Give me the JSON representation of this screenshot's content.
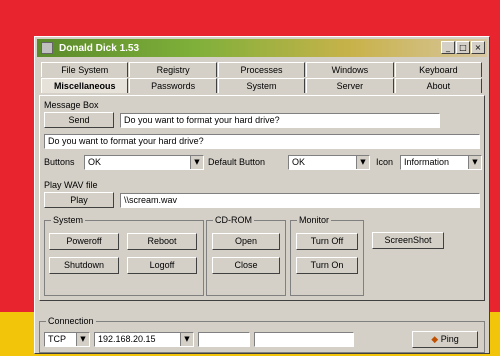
{
  "window": {
    "title": "Donald Dick 1.53",
    "min_label": "_",
    "max_label": "□",
    "close_label": "×"
  },
  "tabs_row1": [
    "File System",
    "Registry",
    "Processes",
    "Windows",
    "Keyboard"
  ],
  "tabs_row2": [
    "Miscellaneous",
    "Passwords",
    "System",
    "Server",
    "About"
  ],
  "message_box": {
    "group_label": "Message Box",
    "send_label": "Send",
    "message_value": "Do you want to format your hard drive?",
    "preview_text": "Do you want to format your hard drive?",
    "buttons_label": "Buttons",
    "buttons_value": "OK",
    "default_button_label": "Default Button",
    "default_button_value": "OK",
    "icon_label": "Icon",
    "icon_value": "Information"
  },
  "play_wav": {
    "group_label": "Play WAV file",
    "play_label": "Play",
    "file_value": "\\\\scream.wav"
  },
  "system": {
    "group_label": "System",
    "poweroff_label": "Poweroff",
    "reboot_label": "Reboot",
    "shutdown_label": "Shutdown",
    "logoff_label": "Logoff"
  },
  "cdrom": {
    "group_label": "CD-ROM",
    "open_label": "Open",
    "close_label": "Close"
  },
  "monitor": {
    "group_label": "Monitor",
    "turn_off_label": "Turn Off",
    "turn_on_label": "Turn On"
  },
  "screenshot_label": "ScreenShot",
  "connection": {
    "group_label": "Connection",
    "protocol_value": "TCP",
    "host_value": "192.168.20.15",
    "ping_label": "Ping"
  }
}
